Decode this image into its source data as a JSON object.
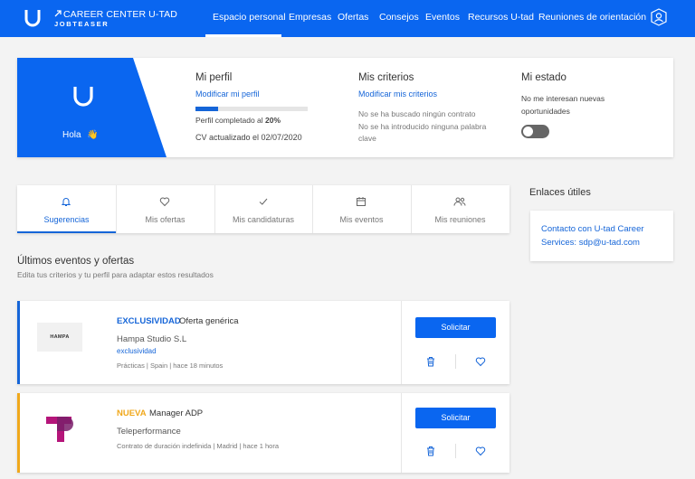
{
  "colors": {
    "primary": "#0a66f0",
    "link": "#1565d8",
    "exclusive": "#1565d8",
    "new": "#f0a81c"
  },
  "brand": {
    "line1": "CAREER CENTER U-TAD",
    "line2": "JOBTEASER"
  },
  "nav": {
    "items": [
      {
        "label": "Espacio personal",
        "active": true
      },
      {
        "label": "Empresas"
      },
      {
        "label": "Ofertas"
      },
      {
        "label": "Consejos"
      },
      {
        "label": "Eventos"
      },
      {
        "label": "Recursos U-tad"
      },
      {
        "label": "Reuniones de orientación"
      }
    ],
    "user_icon": "user-icon"
  },
  "profile": {
    "greeting": "Hola",
    "greeting_icon": "waving-hand-icon",
    "mi_perfil": {
      "title": "Mi perfil",
      "link": "Modificar mi perfil",
      "progress_percent": 20,
      "progress_prefix": "Perfil completado al ",
      "progress_value": "20%",
      "cv_text": "CV actualizado el 02/07/2020"
    },
    "criterios": {
      "title": "Mis criterios",
      "link": "Modificar mis criterios",
      "line1": "No se ha buscado ningún contrato",
      "line2": "No se ha introducido ninguna palabra",
      "line3": "clave"
    },
    "estado": {
      "title": "Mi estado",
      "line1": "No me interesan nuevas",
      "line2": "oportunidades",
      "toggle_on": false
    }
  },
  "tabs": [
    {
      "label": "Sugerencias",
      "icon": "bell-icon",
      "active": true
    },
    {
      "label": "Mis ofertas",
      "icon": "heart-icon"
    },
    {
      "label": "Mis candidaturas",
      "icon": "check-icon"
    },
    {
      "label": "Mis eventos",
      "icon": "calendar-icon"
    },
    {
      "label": "Mis reuniones",
      "icon": "people-icon"
    }
  ],
  "enlaces": {
    "title": "Enlaces útiles",
    "link_line1": "Contacto con U-tad Career",
    "link_line2": "Services: sdp@u-tad.com"
  },
  "list": {
    "title": "Últimos eventos y ofertas",
    "subtitle": "Edita tus criterios y tu perfil para adaptar estos resultados"
  },
  "offers": [
    {
      "tag": "EXCLUSIVIDAD",
      "title": "Oferta genérica",
      "company": "Hampa Studio S.L",
      "badge": "exclusividad",
      "meta": "Prácticas   |   Spain   |   hace 18 minutos",
      "apply": "Solicitar",
      "logo_text": "HAMPA"
    },
    {
      "tag": "NUEVA",
      "title": "Manager ADP",
      "company": "Teleperformance",
      "meta": "Contrato de duración indefinida   |   Madrid   |   hace 1 hora",
      "apply": "Solicitar"
    }
  ]
}
